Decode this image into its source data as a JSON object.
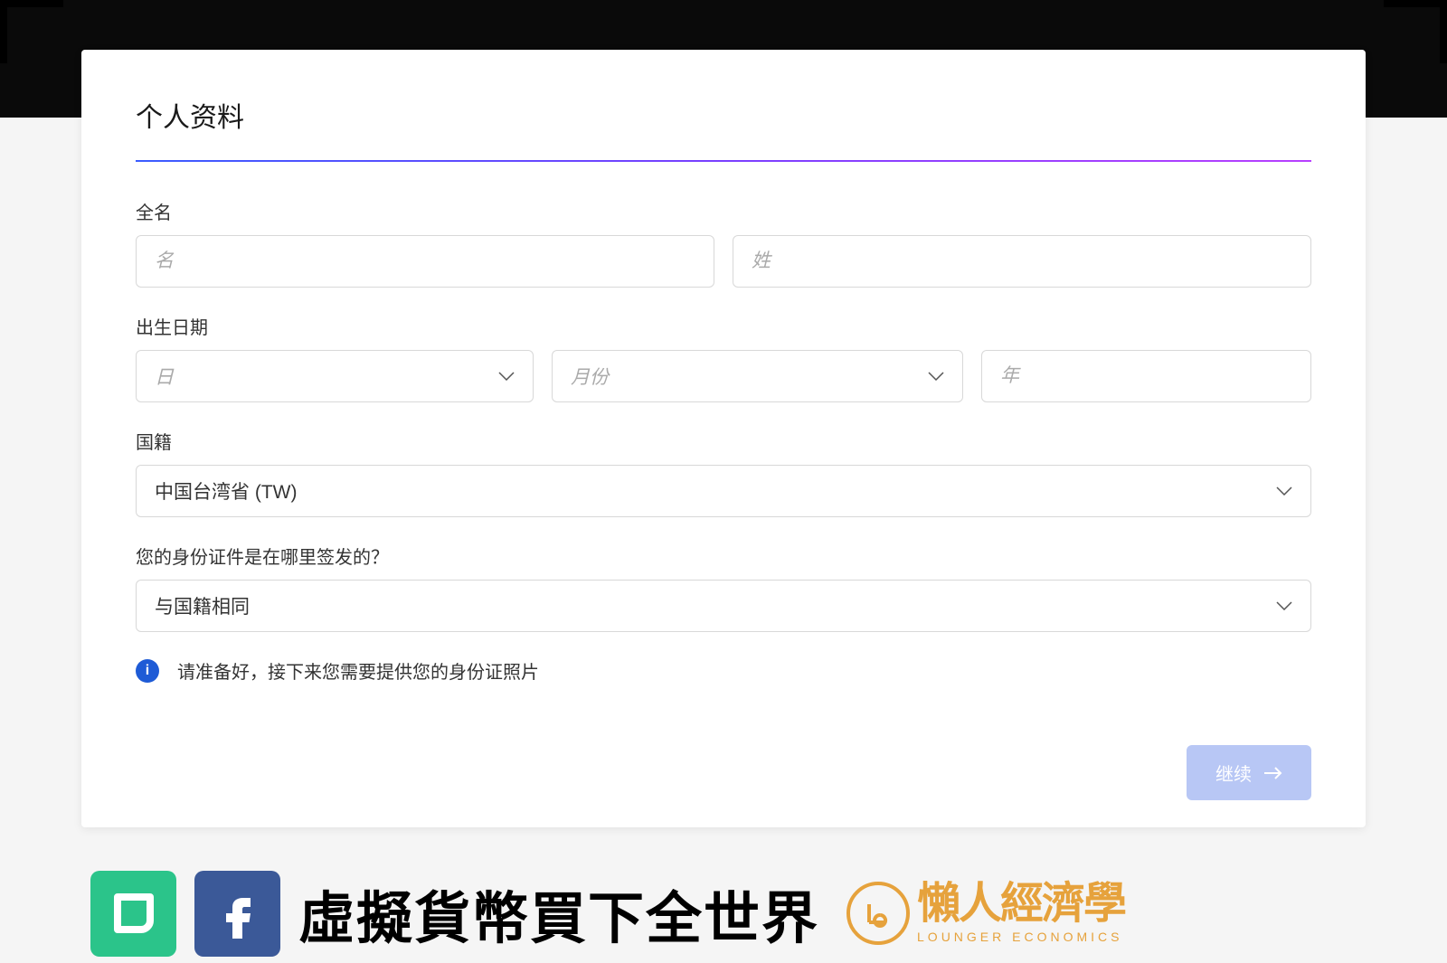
{
  "form": {
    "title": "个人资料",
    "full_name_label": "全名",
    "first_name_placeholder": "名",
    "last_name_placeholder": "姓",
    "dob_label": "出生日期",
    "day_placeholder": "日",
    "month_placeholder": "月份",
    "year_placeholder": "年",
    "nationality_label": "国籍",
    "nationality_value": "中国台湾省 (TW)",
    "id_issue_label": "您的身份证件是在哪里签发的？",
    "id_issue_value": "与国籍相同",
    "info_text": "请准备好，接下来您需要提供您的身份证照片",
    "continue_label": "继续"
  },
  "banner": {
    "main_text": "虛擬貨幣買下全世界",
    "lounger_cn": "懶人經濟學",
    "lounger_en": "LOUNGER ECONOMICS"
  }
}
